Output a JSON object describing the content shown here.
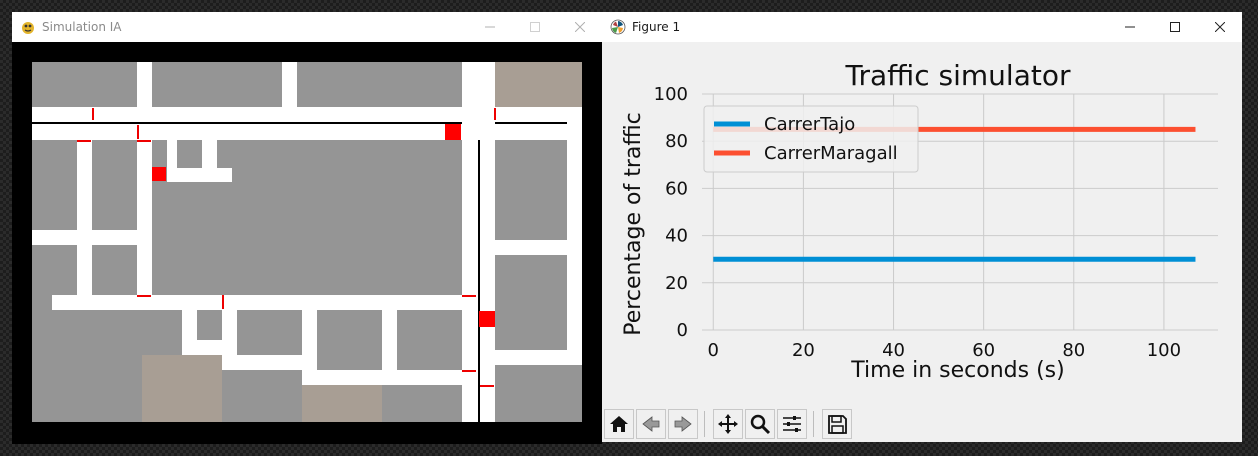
{
  "sim_window": {
    "title": "Simulation IA",
    "controls": [
      "minimize-icon",
      "maximize-icon",
      "close-icon"
    ]
  },
  "figure_window": {
    "title": "Figure 1",
    "controls": [
      "minimize-icon",
      "maximize-icon",
      "close-icon"
    ],
    "toolbar": [
      "home-icon",
      "back-icon",
      "forward-icon",
      "pan-icon",
      "zoom-icon",
      "configure-subplots-icon",
      "save-icon"
    ]
  },
  "chart_data": {
    "type": "line",
    "title": "Traffic simulator",
    "xlabel": "Time in seconds (s)",
    "ylabel": "Percentage of traffic",
    "xlim": [
      -2.5,
      112
    ],
    "ylim": [
      0,
      100
    ],
    "xticks": [
      0,
      20,
      40,
      60,
      80,
      100
    ],
    "yticks": [
      0,
      20,
      40,
      60,
      80,
      100
    ],
    "grid": true,
    "legend_position": "upper-left",
    "series": [
      {
        "name": "CarrerTajo",
        "color": "#008fd5",
        "x": [
          0,
          107
        ],
        "values": [
          30,
          30
        ]
      },
      {
        "name": "CarrerMaragall",
        "color": "#fc4f30",
        "x": [
          0,
          107
        ],
        "values": [
          85,
          85
        ]
      }
    ]
  }
}
